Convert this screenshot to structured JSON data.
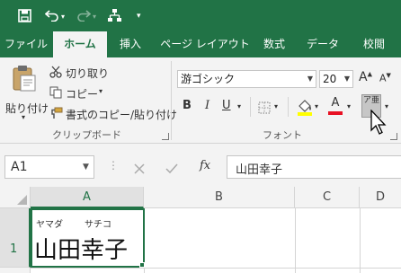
{
  "colors": {
    "accent": "#217346",
    "ribbon_bg": "#f3f3f3",
    "active_cell_border": "#217346",
    "font_color_bar": "#e81123",
    "fill_color_bar": "#ffff00"
  },
  "quick_access": {
    "save_icon": "save-icon",
    "undo_icon": "undo-icon",
    "redo_icon": "redo-icon",
    "custom_icon": "tree-icon",
    "more_label": "▾"
  },
  "tabs": [
    {
      "label": "ファイル",
      "active": false
    },
    {
      "label": "ホーム",
      "active": true
    },
    {
      "label": "挿入",
      "active": false
    },
    {
      "label": "ページ レイアウト",
      "active": false
    },
    {
      "label": "数式",
      "active": false
    },
    {
      "label": "データ",
      "active": false
    },
    {
      "label": "校閲",
      "active": false
    }
  ],
  "ribbon": {
    "clipboard": {
      "paste_label": "貼り付け",
      "cut_label": "切り取り",
      "copy_label": "コピー",
      "format_painter_label": "書式のコピー/貼り付け",
      "group_label": "クリップボード"
    },
    "font": {
      "font_name": "游ゴシック",
      "font_size": "20",
      "grow_label": "A",
      "shrink_label": "A",
      "bold_label": "B",
      "italic_label": "I",
      "underline_label": "U",
      "font_color_label": "A",
      "phonetic_label": "ア亜",
      "group_label": "フォント"
    }
  },
  "formula_bar": {
    "name_box_value": "A1",
    "fx_label": "fx",
    "formula_value": "山田幸子"
  },
  "grid": {
    "columns": [
      "A",
      "B",
      "C",
      "D"
    ],
    "rows": [
      "1"
    ],
    "cell_a1": {
      "phonetic_family": "ヤマダ",
      "phonetic_given": "サチコ",
      "value": "山田幸子"
    }
  }
}
